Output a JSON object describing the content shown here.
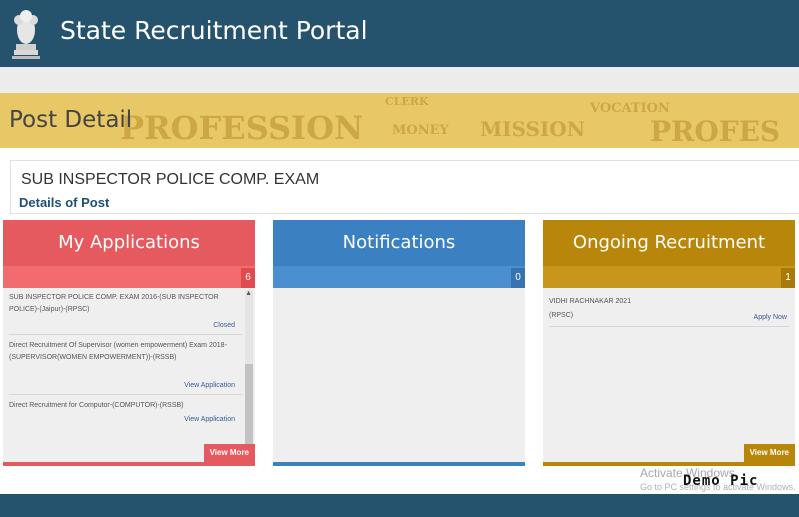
{
  "header": {
    "title": "State Recruitment Portal"
  },
  "page": {
    "title": "Post Detail",
    "banner_words": [
      "CLERK",
      "PROFESSION",
      "MONEY",
      "MISSION",
      "VOCATION",
      "PROFES"
    ]
  },
  "post": {
    "name": "SUB INSPECTOR POLICE COMP. EXAM",
    "details_link": "Details of Post"
  },
  "panels": {
    "applications": {
      "title": "My Applications",
      "count": "6",
      "color": "#e55a5f",
      "items": [
        {
          "text": "SUB INSPECTOR POLICE COMP. EXAM 2016-(SUB INSPECTOR POLICE)-(Jaipur)-(RPSC)",
          "action": "Closed"
        },
        {
          "text": "Direct Recruitment Of Supervisor (women empowerment) Exam 2018-(SUPERVISOR(WOMEN EMPOWERMENT))-(RSSB)",
          "action": "View Application"
        },
        {
          "text": "Direct Recruitment for Computor-(COMPUTOR)-(RSSB)",
          "action": "View Application"
        }
      ],
      "view_more": "View More"
    },
    "notifications": {
      "title": "Notifications",
      "count": "0",
      "color": "#3b80c0"
    },
    "ongoing": {
      "title": "Ongoing Recruitment",
      "count": "1",
      "color": "#b8860b",
      "items": [
        {
          "text_line1": "VIDHI RACHNAKAR 2021",
          "text_line2": "(RPSC)",
          "action": "Apply Now"
        }
      ],
      "view_more": "View More"
    }
  },
  "overlay": {
    "activate_line1": "Activate Windows",
    "activate_line2": "Go to PC settings to activate Windows.",
    "demo": "Demo Pic"
  }
}
